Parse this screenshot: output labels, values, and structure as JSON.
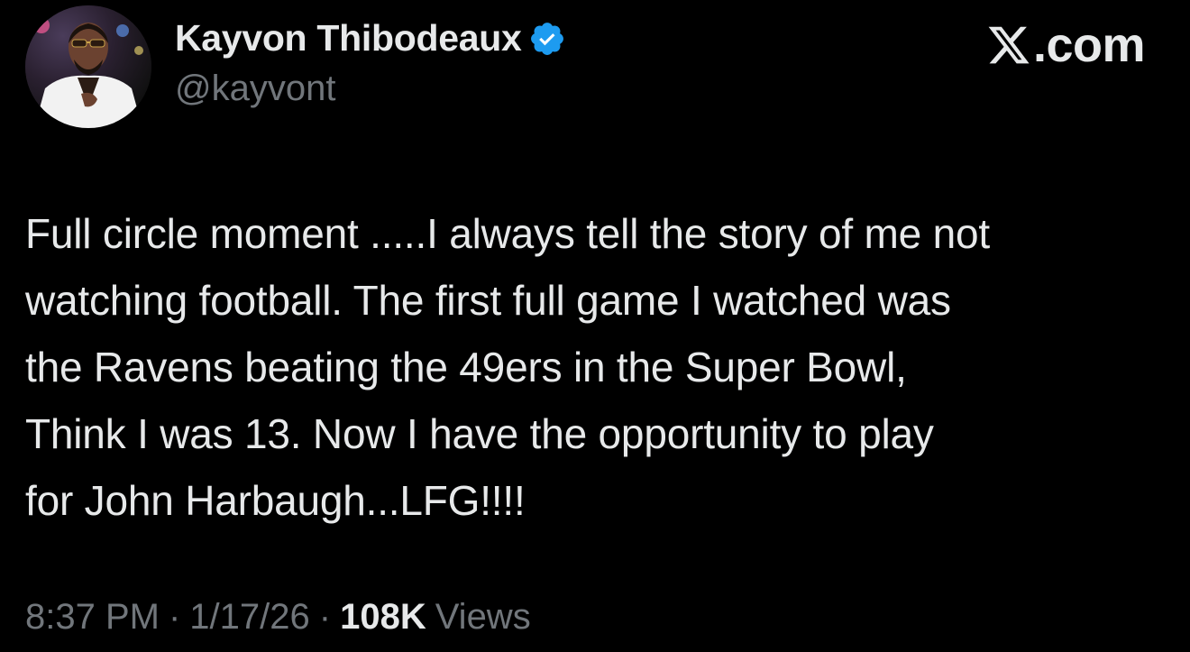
{
  "author": {
    "display_name": "Kayvon Thibodeaux",
    "handle": "@kayvont",
    "verified": true,
    "verified_color": "#1d9bf0",
    "avatar_icon": "profile-photo"
  },
  "brand": {
    "label": ".com",
    "logo_icon": "x-logo-icon"
  },
  "tweet": {
    "text": "Full circle moment .....I always tell the story of me not\nwatching football. The first full game I watched was\nthe Ravens beating the 49ers in the Super Bowl,\nThink I was 13. Now I have the opportunity to play\nfor John Harbaugh...LFG!!!!"
  },
  "meta": {
    "time": "8:37 PM",
    "separator": "·",
    "date": "1/17/26",
    "views_count": "108K",
    "views_label": "Views"
  },
  "colors": {
    "background": "#000000",
    "primary_text": "#e7e9ea",
    "secondary_text": "#71767b",
    "accent": "#1d9bf0"
  }
}
